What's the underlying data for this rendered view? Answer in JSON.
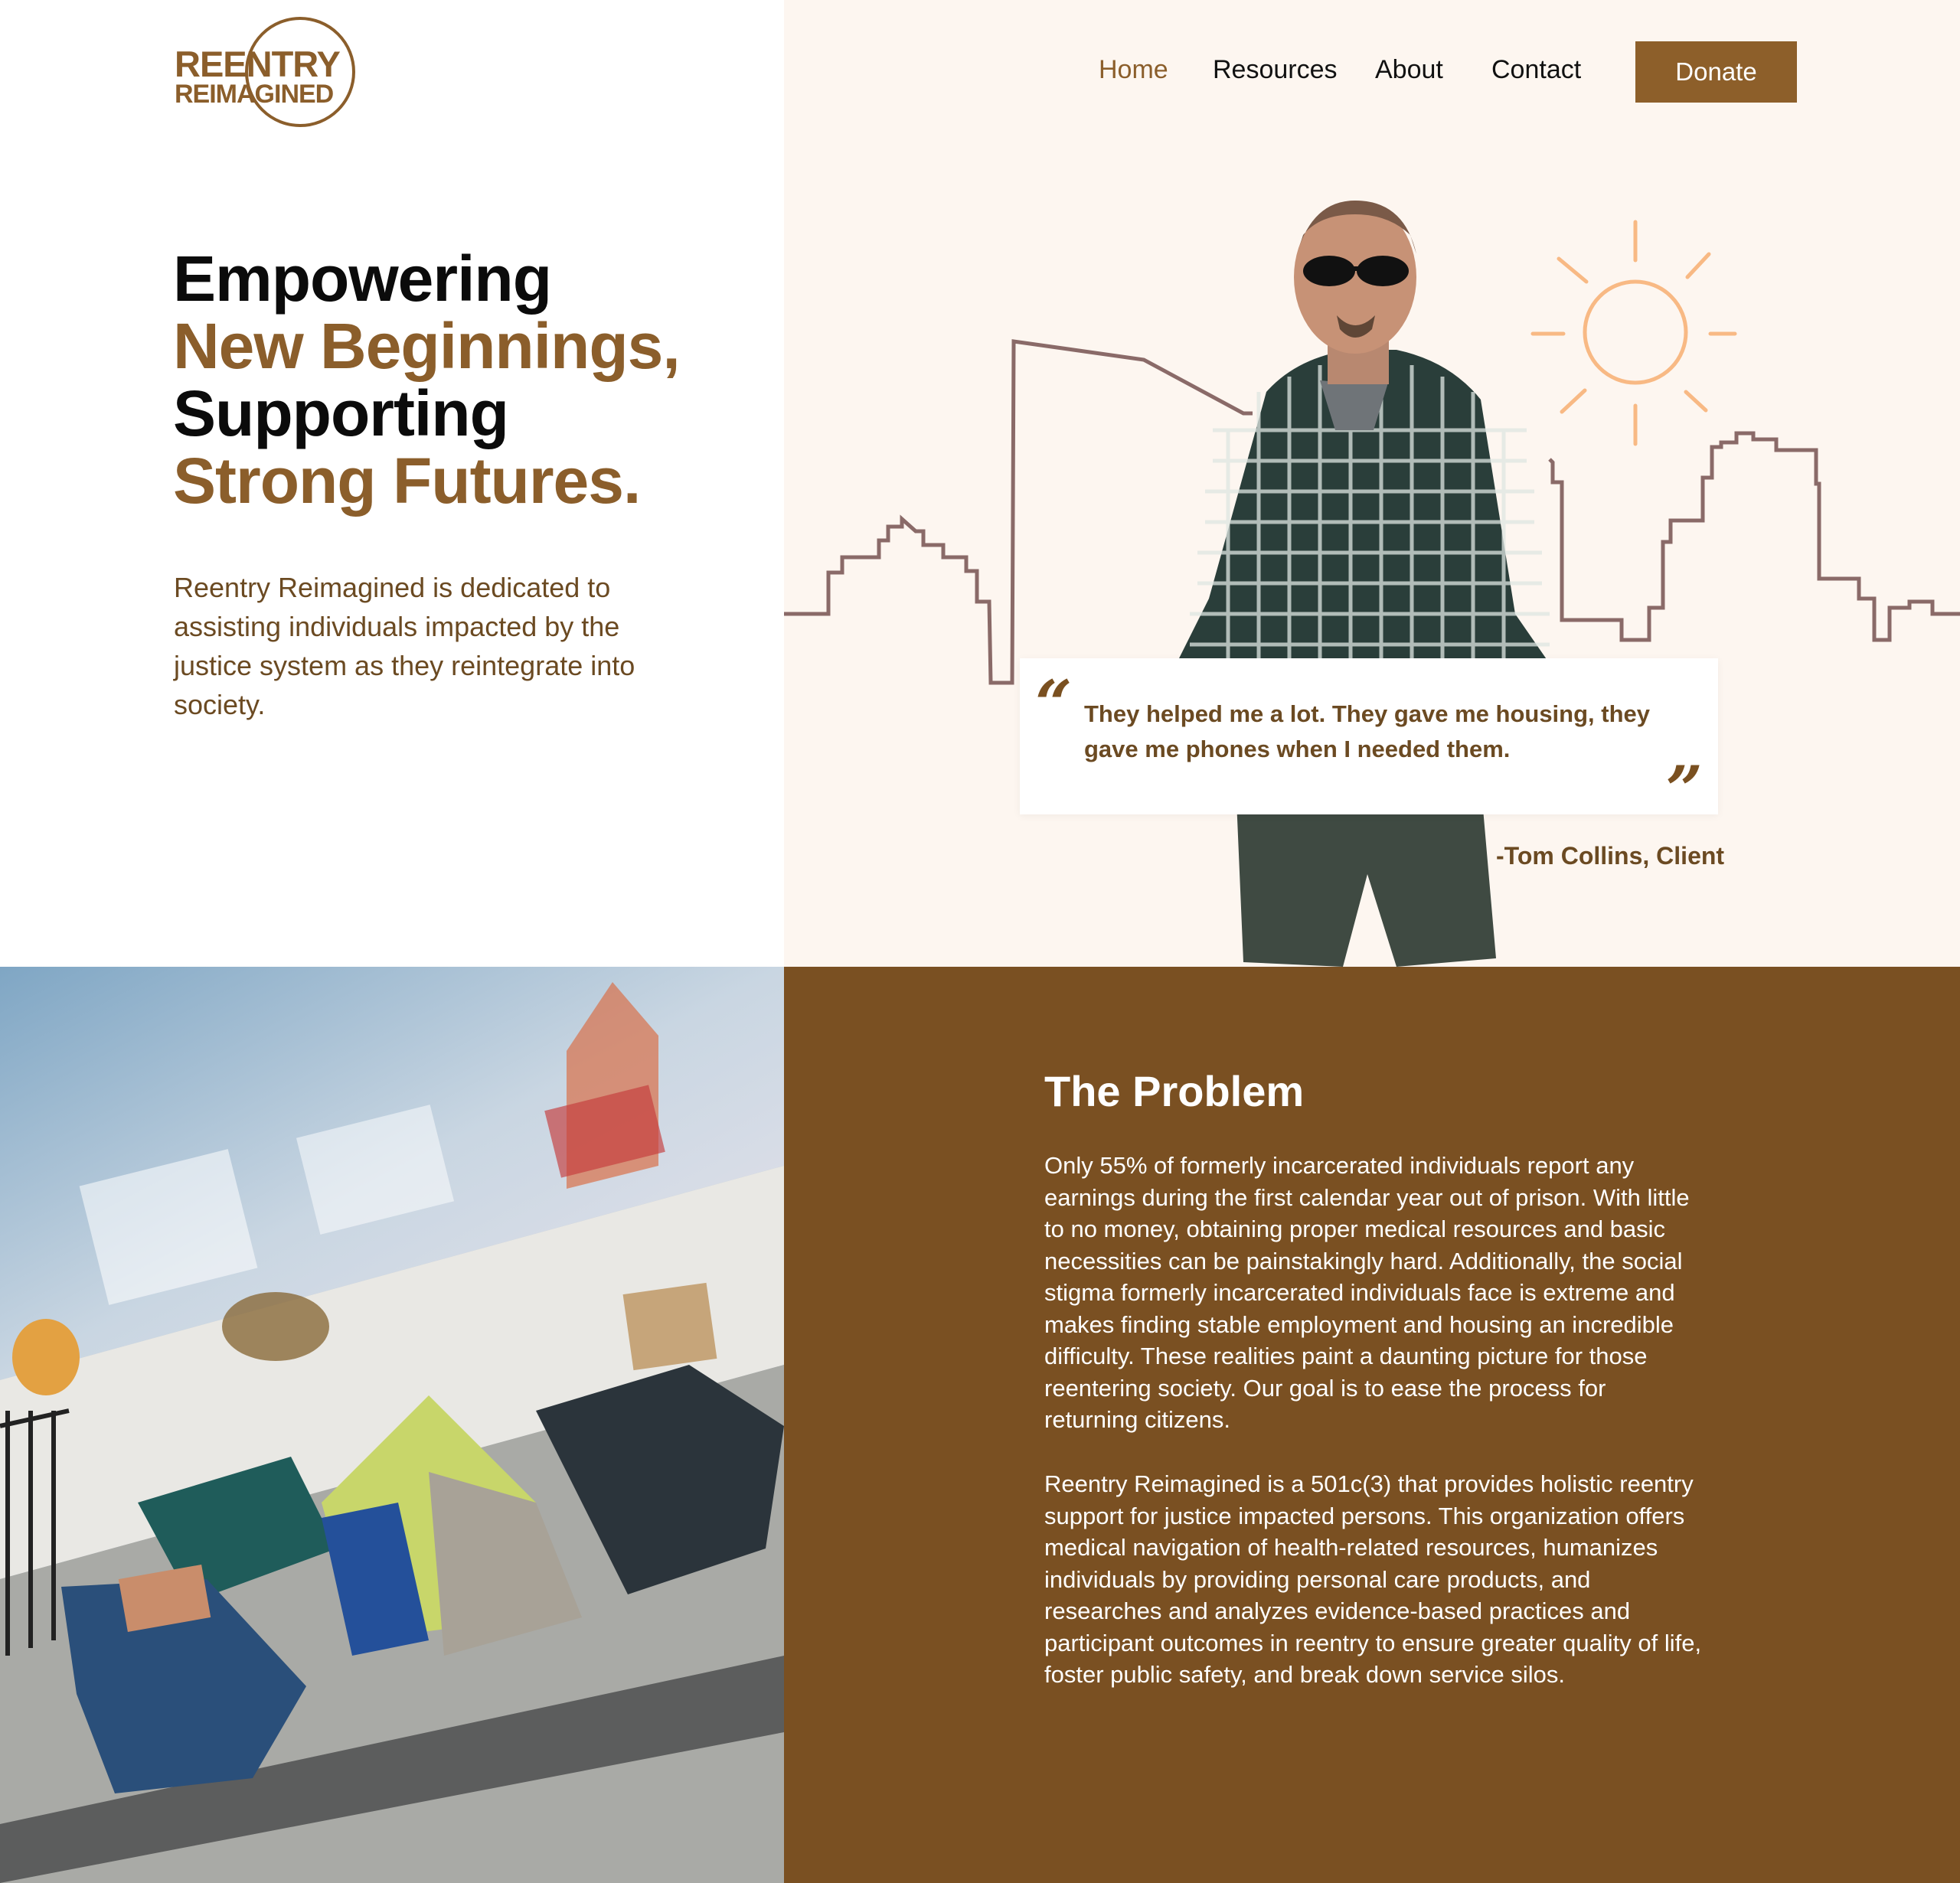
{
  "brand": {
    "logo_line1": "REENTRY",
    "logo_line2": "REIMAGINED",
    "brand_color": "#8b5e2b"
  },
  "nav": {
    "items": [
      {
        "label": "Home",
        "active": true
      },
      {
        "label": "Resources",
        "active": false
      },
      {
        "label": "About",
        "active": false
      },
      {
        "label": "Contact",
        "active": false
      }
    ],
    "donate_label": "Donate"
  },
  "hero": {
    "headline": [
      "Empowering",
      "New Beginnings,",
      "Supporting",
      "Strong Futures."
    ],
    "intro": "Reentry Reimagined is dedicated to assisting individuals impacted by the justice system as they reintegrate into society.",
    "quote": "They helped me a lot. They gave me housing, they gave me phones when I needed them.",
    "quote_open": "“",
    "quote_close": "”",
    "quote_author": "-Tom Collins, Client"
  },
  "problem": {
    "title": "The Problem",
    "paragraph1": "Only 55% of formerly incarcerated individuals report any earnings during the first calendar year out of prison. With little to no money, obtaining proper medical resources and basic necessities can be painstakingly hard. Additionally, the social stigma formerly incarcerated individuals face is extreme and makes finding stable employment and housing an incredible difficulty. These realities paint a daunting picture for those reentering society. Our goal is to ease the process for returning citizens.",
    "paragraph2": "Reentry Reimagined is a 501c(3) that provides holistic reentry support for justice impacted persons. This organization offers medical navigation of health-related resources, humanizes individuals by providing personal care products, and researches and analyzes evidence-based practices and participant outcomes in reentry to ensure greater quality of life, foster public safety, and break down service silos.",
    "panel_color": "#7a5022"
  },
  "colors": {
    "accent": "#8d5f2a",
    "hero_right_bg": "#fdf6f0",
    "skyline": "#8a6a68",
    "sun": "#f8b984"
  }
}
